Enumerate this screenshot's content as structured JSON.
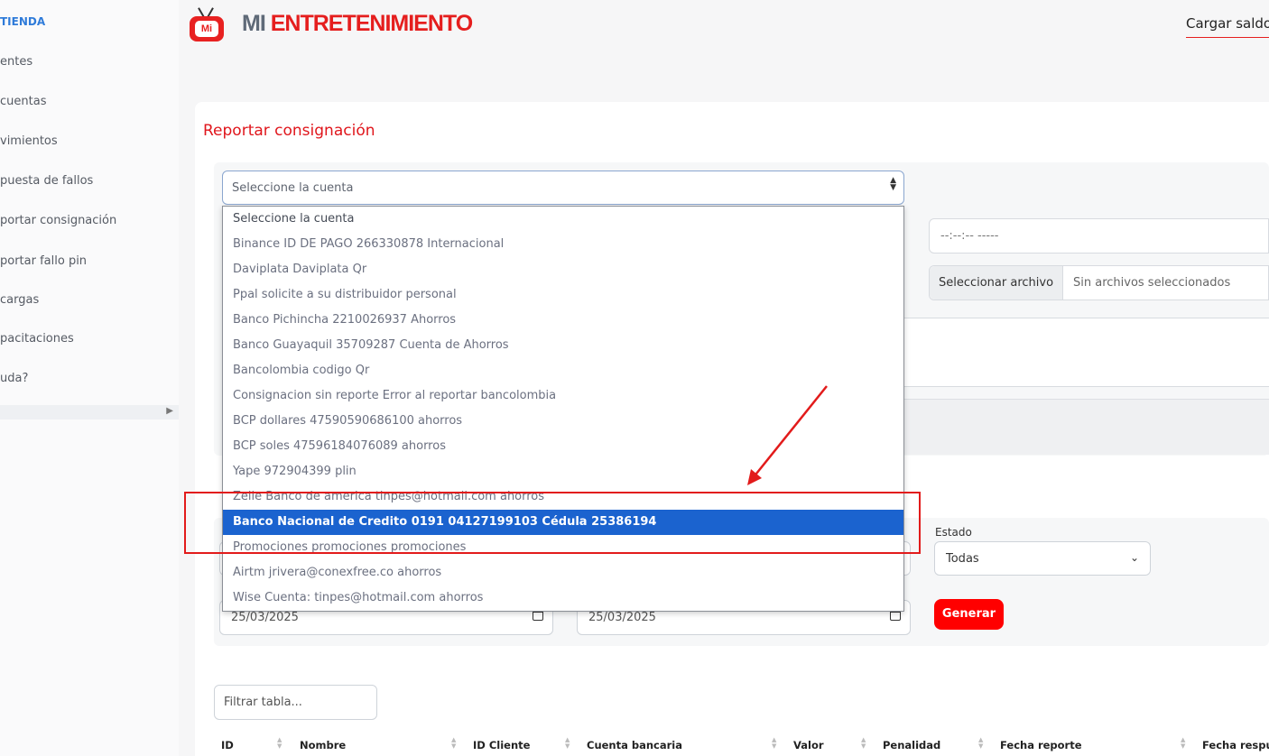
{
  "sidebar": {
    "items": [
      {
        "label": "TIENDA"
      },
      {
        "label": "entes"
      },
      {
        "label": "cuentas"
      },
      {
        "label": "vimientos"
      },
      {
        "label": "puesta de fallos"
      },
      {
        "label": "portar consignación"
      },
      {
        "label": "portar fallo pin"
      },
      {
        "label": "cargas"
      },
      {
        "label": "pacitaciones"
      },
      {
        "label": "uda?"
      }
    ]
  },
  "header": {
    "brand_mi": "MI",
    "brand_rest": "ENTRETENIMIENTO",
    "logo_text": "Mi",
    "cargar_saldo": "Cargar saldo"
  },
  "form": {
    "title": "Reportar consignación",
    "account_select": "Seleccione la cuenta",
    "time_value": "--:--:-- -----",
    "file_button": "Seleccionar archivo",
    "file_status": "Sin archivos seleccionados"
  },
  "dropdown": {
    "options": [
      "Seleccione la cuenta",
      "Binance ID DE PAGO 266330878 Internacional",
      "Daviplata Daviplata Qr",
      "Ppal solicite a su distribuidor personal",
      "Banco Pichincha 2210026937 Ahorros",
      "Banco Guayaquil 35709287 Cuenta de Ahorros",
      "Bancolombia codigo Qr",
      "Consignacion sin reporte Error al reportar bancolombia",
      "BCP dollares 47590590686100 ahorros",
      "BCP soles 47596184076089 ahorros",
      "Yape 972904399 plin",
      "Zelle Banco de america tinpes@hotmail.com ahorros",
      "Banco Nacional de Credito 0191 04127199103 Cédula 25386194",
      "Promociones promociones promociones",
      "Airtm jrivera@conexfree.co ahorros",
      "Wise Cuenta: tinpes@hotmail.com ahorros"
    ],
    "selected_index": 12
  },
  "filters": {
    "estado_label": "Estado",
    "estado_value": "Todas",
    "date_from": "25/03/2025",
    "date_to": "25/03/2025",
    "generar": "Generar",
    "filtrar_placeholder": "Filtrar tabla..."
  },
  "table": {
    "headers": [
      "ID",
      "Nombre",
      "ID Cliente",
      "Cuenta bancaria",
      "Valor",
      "Penalidad",
      "Fecha reporte",
      "Fecha respue"
    ]
  },
  "colors": {
    "brand_red": "#e51e1e",
    "selected_blue": "#1b63cf",
    "annotation_red": "#e21b1b"
  }
}
